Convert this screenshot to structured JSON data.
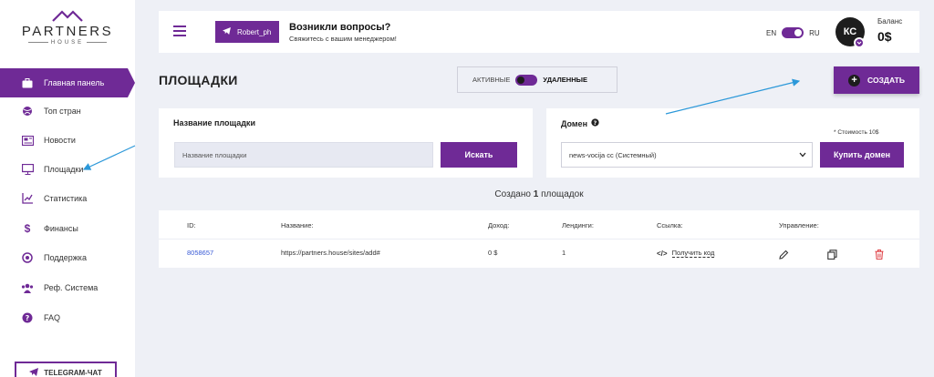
{
  "brand": {
    "name": "PARTNERS",
    "sub": "HOUSE"
  },
  "sidebar": {
    "items": [
      {
        "label": "Главная панель",
        "icon": "briefcase-icon",
        "active": true
      },
      {
        "label": "Топ стран",
        "icon": "globe-icon",
        "active": false
      },
      {
        "label": "Новости",
        "icon": "newspaper-icon",
        "active": false
      },
      {
        "label": "Площадки",
        "icon": "monitor-icon",
        "active": false
      },
      {
        "label": "Статистика",
        "icon": "chart-icon",
        "active": false
      },
      {
        "label": "Финансы",
        "icon": "dollar-icon",
        "active": false
      },
      {
        "label": "Поддержка",
        "icon": "support-icon",
        "active": false
      },
      {
        "label": "Реф. Система",
        "icon": "users-icon",
        "active": false
      },
      {
        "label": "FAQ",
        "icon": "question-icon",
        "active": false
      }
    ],
    "telegram_label": "TELEGRAM-ЧАТ"
  },
  "header": {
    "manager_name": "Robert_ph",
    "question_title": "Возникли вопросы?",
    "question_sub": "Свяжитесь с вашим менеджером!",
    "lang_en": "EN",
    "lang_ru": "RU",
    "avatar_initials": "КС",
    "balance_label": "Баланс",
    "balance_value": "0$"
  },
  "page": {
    "title": "ПЛОЩАДКИ",
    "filter_active": "АКТИВНЫЕ",
    "filter_deleted": "УДАЛЕННЫЕ",
    "create_label": "СОЗДАТЬ"
  },
  "search_card": {
    "label": "Название площадки",
    "placeholder": "Название площадки",
    "button": "Искать"
  },
  "domain_card": {
    "label": "Домен",
    "selected": "news-vocija cc (Системный)",
    "price_note": "* Стоимость 10$",
    "button": "Купить домен"
  },
  "created_summary": {
    "prefix": "Создано",
    "count": "1",
    "suffix": "площадок"
  },
  "table": {
    "headers": {
      "id": "ID:",
      "name": "Название:",
      "income": "Доход:",
      "landings": "Лендинги:",
      "link": "Ссылка:",
      "manage": "Управление:"
    },
    "rows": [
      {
        "id": "8058657",
        "name": "https://partners.house/sites/add#",
        "income": "0 $",
        "landings": "1",
        "link": "Получить код"
      }
    ]
  },
  "colors": {
    "accent": "#6f2a96",
    "background": "#eef0f6",
    "link": "#3a5bd6",
    "delete": "#e0474c"
  }
}
